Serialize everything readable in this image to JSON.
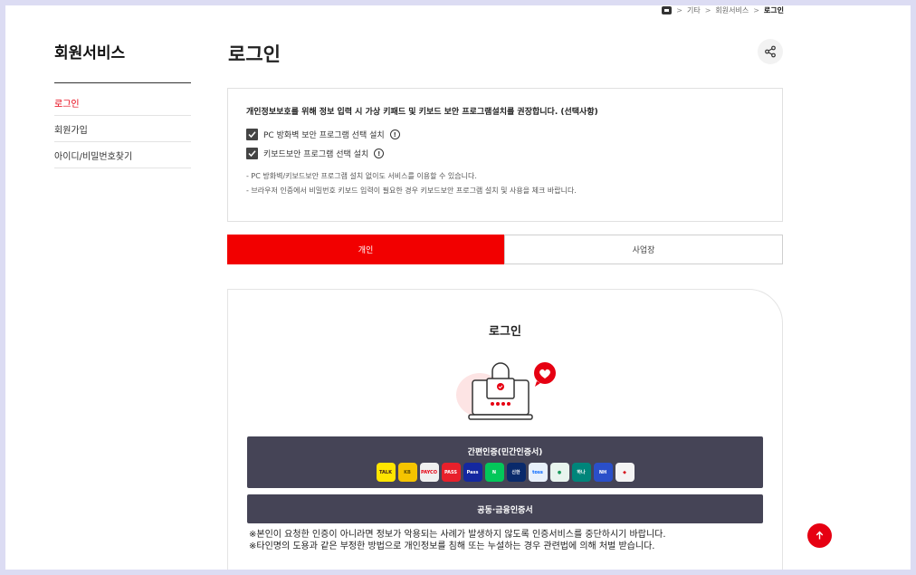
{
  "breadcrumb": [
    "기타",
    "회원서비스",
    "로그인"
  ],
  "sidebar": {
    "title": "회원서비스",
    "items": [
      {
        "label": "로그인"
      },
      {
        "label": "회원가입"
      },
      {
        "label": "아이디/비밀번호찾기"
      }
    ]
  },
  "page_title": "로그인",
  "security": {
    "headline": "개인정보보호를 위해 정보 입력 시 가상 키패드 및 키보드 보안 프로그램설치를 권장합니다. (선택사항)",
    "checks": [
      {
        "label": "PC 방화벽 보안 프로그램 선택 설치",
        "checked": true
      },
      {
        "label": "키보드보안 프로그램 선택 설치",
        "checked": true
      }
    ],
    "notes": [
      "- PC 방화벽/키보드보안 프로그램 설치 없이도 서비스를 이용할 수 있습니다.",
      "- 브라우저 인증에서 비밀번호 키보드 입력이 필요한 경우 키보드보안 프로그램 설치 및 사용을 체크 바랍니다."
    ]
  },
  "tabs": [
    {
      "label": "개인",
      "active": true
    },
    {
      "label": "사업장",
      "active": false
    }
  ],
  "login": {
    "title": "로그인",
    "simple_auth_label": "간편인증(민간인증서)",
    "providers": [
      {
        "name": "kakao",
        "text": "TALK",
        "color": "#fee500",
        "text_color": "#3c1e1e"
      },
      {
        "name": "kb",
        "text": "KB",
        "color": "#f5c400",
        "text_color": "#5b4a00"
      },
      {
        "name": "payco",
        "text": "PAYCO",
        "color": "#f0f0f0",
        "text_color": "#e60012"
      },
      {
        "name": "pass",
        "text": "PASS",
        "color": "#e8202b",
        "text_color": "#ffffff"
      },
      {
        "name": "samsung-pass",
        "text": "Pass",
        "color": "#1428a0",
        "text_color": "#ffffff"
      },
      {
        "name": "naver",
        "text": "N",
        "color": "#03c75a",
        "text_color": "#ffffff"
      },
      {
        "name": "shinhan",
        "text": "신한",
        "color": "#0a2a6b",
        "text_color": "#ffffff"
      },
      {
        "name": "toss",
        "text": "toss",
        "color": "#e8f0fb",
        "text_color": "#0064ff"
      },
      {
        "name": "bank-green",
        "text": "●",
        "color": "#e8f4ee",
        "text_color": "#1a9a5c"
      },
      {
        "name": "hana",
        "text": "하나",
        "color": "#00857a",
        "text_color": "#ffffff"
      },
      {
        "name": "nh",
        "text": "NH",
        "color": "#2a4fc9",
        "text_color": "#ffffff"
      },
      {
        "name": "banksalad",
        "text": "◆",
        "color": "#f4f4f4",
        "text_color": "#d71920"
      }
    ],
    "cert_label": "공동·금융인증서",
    "warnings": [
      "※본인이 요청한 인증이 아니라면 정보가 악용되는 사례가 발생하지 않도록 인증서비스를 중단하시기 바랍니다.",
      "※타인명의 도용과 같은 부정한 방법으로 개인정보를 침해 또는 누설하는 경우 관련법에 의해 처벌 받습니다."
    ]
  },
  "colors": {
    "accent": "#e60012",
    "tab_active": "#f20000",
    "button_dark": "#454456"
  },
  "icons": {
    "share": "share-icon",
    "home": "home-icon",
    "top": "arrow-up-icon"
  }
}
